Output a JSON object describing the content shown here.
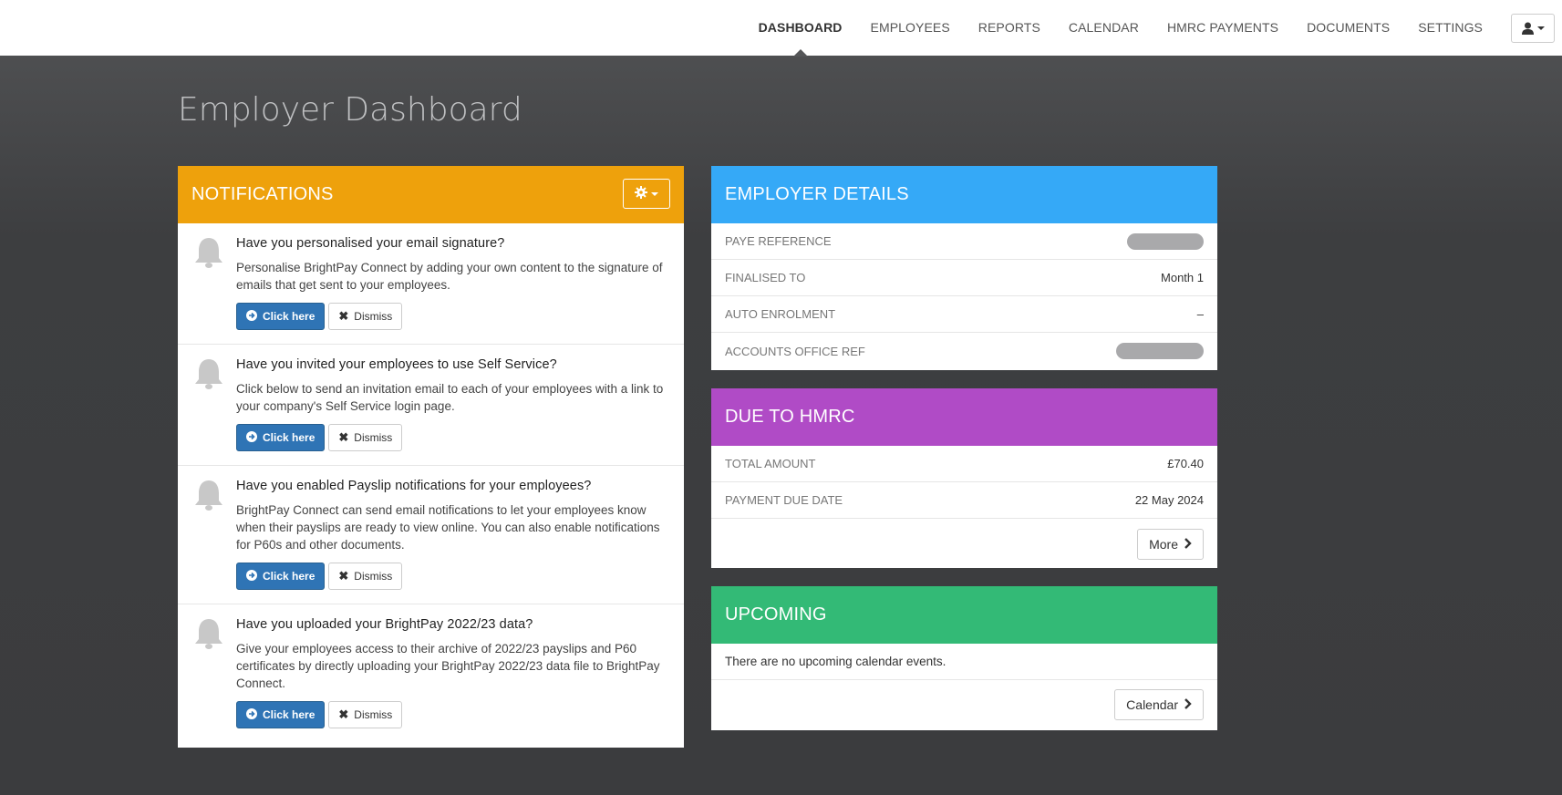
{
  "nav": {
    "items": [
      {
        "label": "DASHBOARD",
        "active": true
      },
      {
        "label": "EMPLOYEES"
      },
      {
        "label": "REPORTS"
      },
      {
        "label": "CALENDAR"
      },
      {
        "label": "HMRC PAYMENTS"
      },
      {
        "label": "DOCUMENTS"
      },
      {
        "label": "SETTINGS"
      }
    ]
  },
  "page": {
    "title": "Employer Dashboard"
  },
  "notifications": {
    "title": "NOTIFICATIONS",
    "items": [
      {
        "heading": "Have you personalised your email signature?",
        "body": "Personalise BrightPay Connect by adding your own content to the signature of emails that get sent to your employees.",
        "primary": "Click here",
        "secondary": "Dismiss"
      },
      {
        "heading": "Have you invited your employees to use Self Service?",
        "body": "Click below to send an invitation email to each of your employees with a link to your company's Self Service login page.",
        "primary": "Click here",
        "secondary": "Dismiss"
      },
      {
        "heading": "Have you enabled Payslip notifications for your employees?",
        "body": "BrightPay Connect can send email notifications to let your employees know when their payslips are ready to view online. You can also enable notifications for P60s and other documents.",
        "primary": "Click here",
        "secondary": "Dismiss"
      },
      {
        "heading": "Have you uploaded your BrightPay 2022/23 data?",
        "body": "Give your employees access to their archive of 2022/23 payslips and P60 certificates by directly uploading your BrightPay 2022/23 data file to BrightPay Connect.",
        "primary": "Click here",
        "secondary": "Dismiss"
      }
    ]
  },
  "employer": {
    "title": "EMPLOYER DETAILS",
    "rows": [
      {
        "label": "PAYE REFERENCE",
        "value": ""
      },
      {
        "label": "FINALISED TO",
        "value": "Month 1"
      },
      {
        "label": "AUTO ENROLMENT",
        "value": "–"
      },
      {
        "label": "ACCOUNTS OFFICE REF",
        "value": ""
      }
    ]
  },
  "hmrc": {
    "title": "DUE TO HMRC",
    "rows": [
      {
        "label": "TOTAL AMOUNT",
        "value": "£70.40"
      },
      {
        "label": "PAYMENT DUE DATE",
        "value": "22 May 2024"
      }
    ],
    "more_label": "More"
  },
  "upcoming": {
    "title": "UPCOMING",
    "empty": "There are no upcoming calendar events.",
    "calendar_label": "Calendar"
  },
  "colors": {
    "notifications": "#eea10c",
    "employer": "#35a9f7",
    "hmrc": "#b04bc6",
    "upcoming": "#33ba76",
    "primary_button": "#2f74b5"
  }
}
